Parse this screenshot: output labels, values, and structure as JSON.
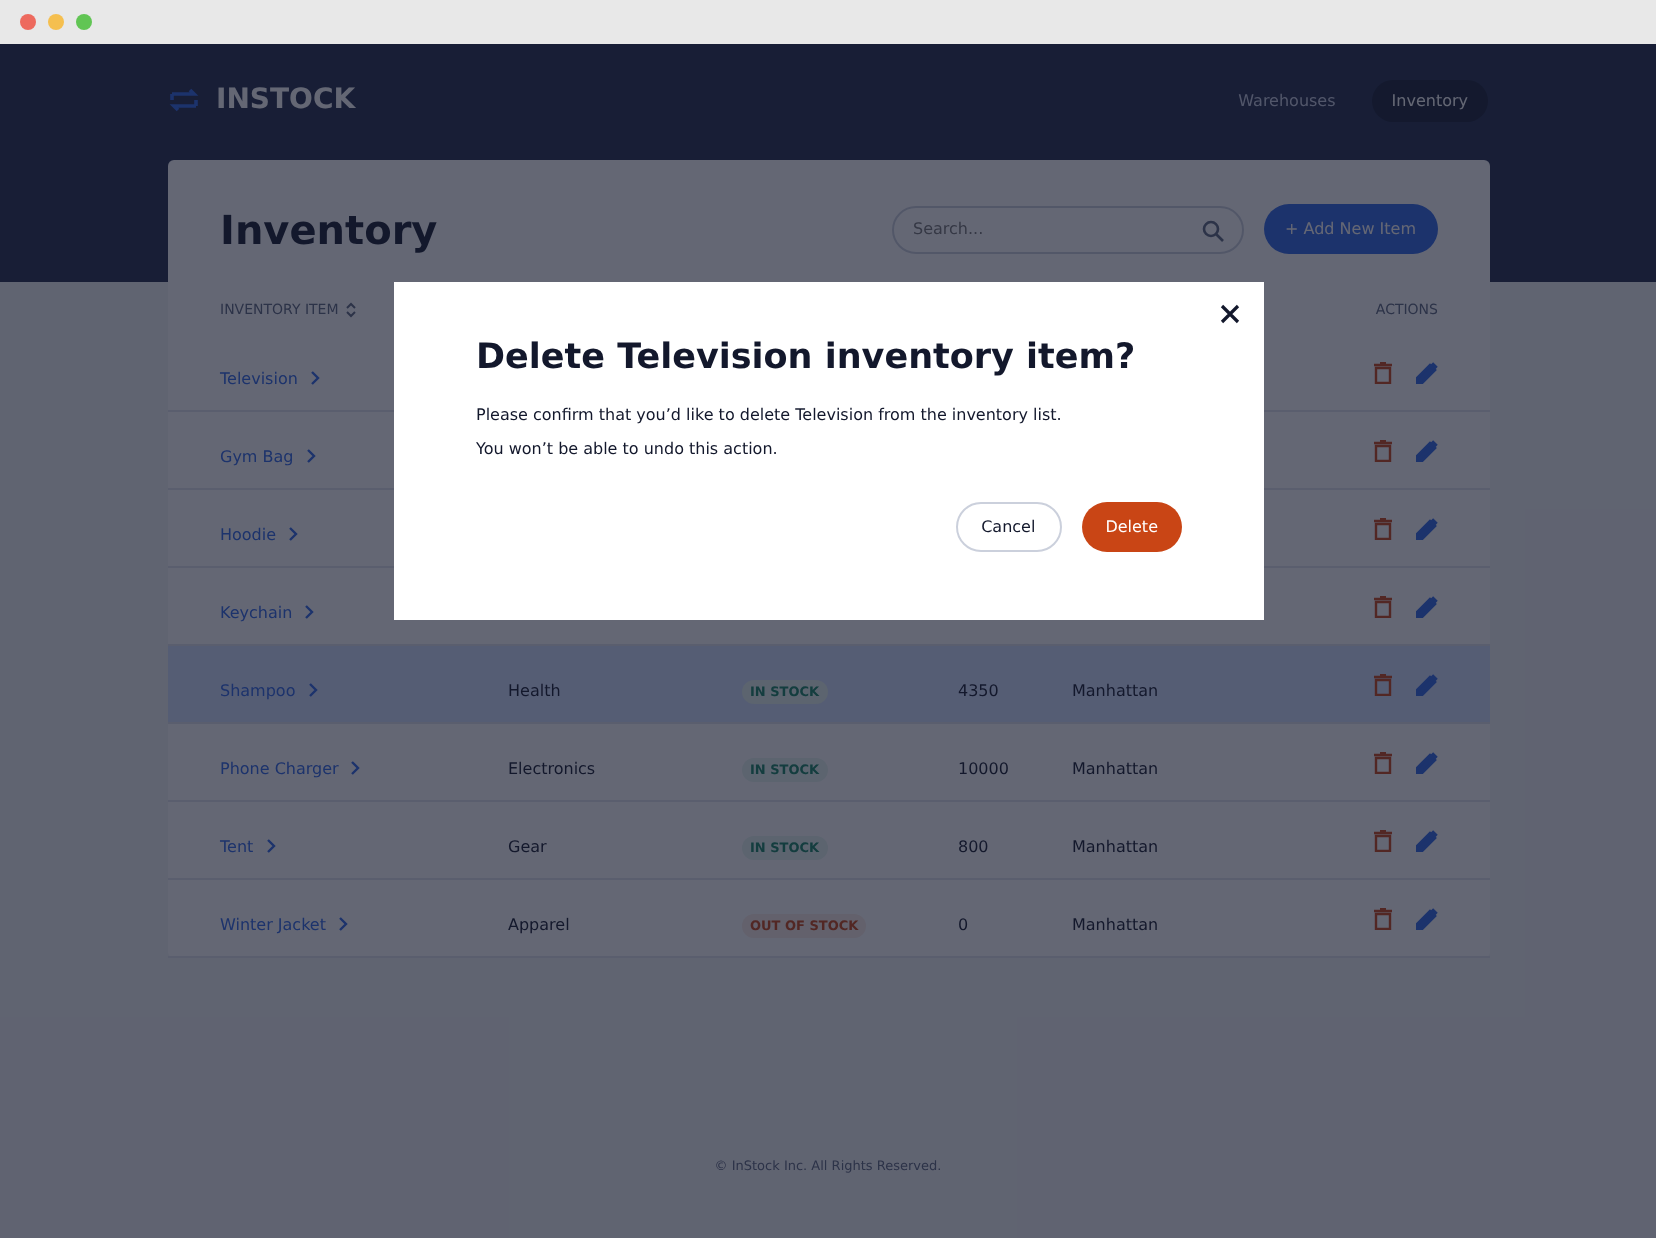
{
  "header": {
    "logo": "INSTOCK",
    "nav": [
      {
        "label": "Warehouses",
        "selected": false
      },
      {
        "label": "Inventory",
        "selected": true
      }
    ]
  },
  "page": {
    "title": "Inventory",
    "search": {
      "placeholder": "Search..."
    },
    "add_button": "+ Add New Item"
  },
  "table": {
    "columns": [
      {
        "label": "INVENTORY ITEM",
        "sortable": true
      },
      {
        "label": "ACTIONS",
        "sortable": false
      }
    ],
    "rows": [
      {
        "name": "Television",
        "highlighted": false
      },
      {
        "name": "Gym Bag",
        "highlighted": false
      },
      {
        "name": "Hoodie",
        "highlighted": false
      },
      {
        "name": "Keychain",
        "highlighted": false
      },
      {
        "name": "Shampoo",
        "category": "Health",
        "status": "IN STOCK",
        "in_stock": true,
        "quantity": "4350",
        "warehouse": "Manhattan",
        "highlighted": true
      },
      {
        "name": "Phone Charger",
        "category": "Electronics",
        "status": "IN STOCK",
        "in_stock": true,
        "quantity": "10000",
        "warehouse": "Manhattan",
        "highlighted": false
      },
      {
        "name": "Tent",
        "category": "Gear",
        "status": "IN STOCK",
        "in_stock": true,
        "quantity": "800",
        "warehouse": "Manhattan",
        "highlighted": false
      },
      {
        "name": "Winter Jacket",
        "category": "Apparel",
        "status": "OUT OF STOCK",
        "in_stock": false,
        "quantity": "0",
        "warehouse": "Manhattan",
        "highlighted": false
      }
    ]
  },
  "footer": "© InStock Inc. All Rights Reserved.",
  "modal": {
    "title": "Delete Television inventory item?",
    "body": [
      "Please confirm that you’d like to delete Television from the inventory list.",
      "You won’t be able to undo this action."
    ],
    "cancel": "Cancel",
    "confirm": "Delete"
  }
}
